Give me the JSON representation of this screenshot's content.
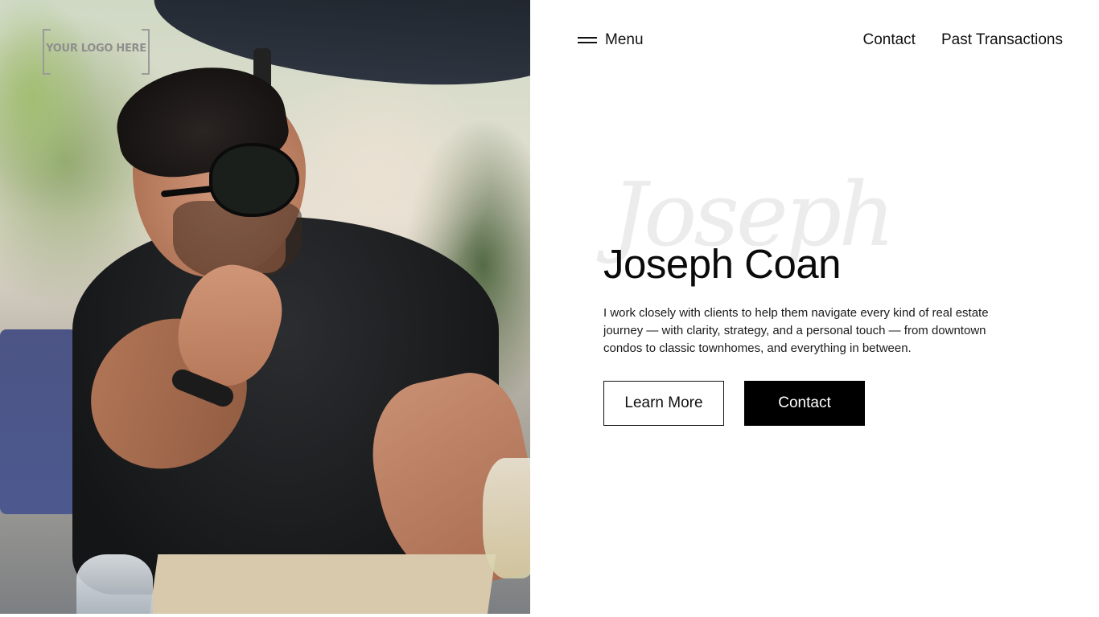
{
  "logo": {
    "text": "YOUR LOGO HERE"
  },
  "nav": {
    "menu_label": "Menu",
    "links": [
      "Contact",
      "Past Transactions"
    ]
  },
  "hero": {
    "script_text": "Joseph",
    "title": "Joseph Coan",
    "description": "I work closely with clients to help them navigate every kind of real estate journey — with clarity, strategy, and a personal touch — from downtown condos to classic townhomes, and everything in between.",
    "buttons": {
      "learn_more": "Learn More",
      "contact": "Contact"
    }
  },
  "colors": {
    "background": "#ffffff",
    "text": "#111111",
    "button_solid": "#000000"
  },
  "icons": [
    "hamburger-menu-icon"
  ]
}
